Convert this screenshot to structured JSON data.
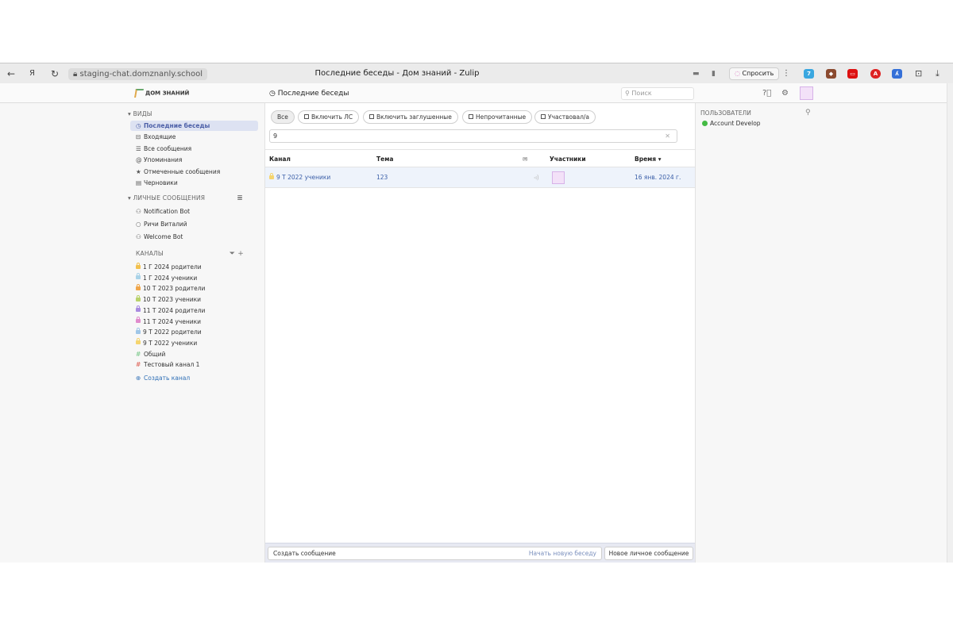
{
  "browser": {
    "back_icon": "arrow-left",
    "yandex_icon": "Я",
    "reload_icon": "reload",
    "url": "staging-chat.domznanly.school",
    "tab_title": "Последние беседы - Дом знаний - Zulip",
    "ask_label": "Спросить"
  },
  "header": {
    "logo_text": "ДОМ ЗНАНИЙ",
    "view_title": "Последние беседы",
    "search_placeholder": "Поиск"
  },
  "views": {
    "title": "ВИДЫ",
    "items": [
      {
        "icon": "clock-icon",
        "glyph": "◷",
        "label": "Последние беседы",
        "active": true
      },
      {
        "icon": "inbox-icon",
        "glyph": "⊟",
        "label": "Входящие"
      },
      {
        "icon": "all-messages-icon",
        "glyph": "☰",
        "label": "Все сообщения"
      },
      {
        "icon": "at-icon",
        "glyph": "@",
        "label": "Упоминания"
      },
      {
        "icon": "star-icon",
        "glyph": "★",
        "label": "Отмеченные сообщения"
      },
      {
        "icon": "draft-icon",
        "glyph": "▤",
        "label": "Черновики"
      }
    ]
  },
  "direct_messages": {
    "title": "ЛИЧНЫЕ СООБЩЕНИЯ",
    "items": [
      {
        "label": "Notification Bot",
        "glyph": "⚇"
      },
      {
        "label": "Ричи Виталий",
        "glyph": "○"
      },
      {
        "label": "Welcome Bot",
        "glyph": "⚇"
      }
    ]
  },
  "channels": {
    "title": "КАНАЛЫ",
    "items": [
      {
        "label": "1 Г 2024 родители",
        "kind": "lock",
        "color": "#f2c14e"
      },
      {
        "label": "1 Г 2024 ученики",
        "kind": "lock",
        "color": "#a9d3e8"
      },
      {
        "label": "10 Т 2023 родители",
        "kind": "lock",
        "color": "#f0a64a"
      },
      {
        "label": "10 Т 2023 ученики",
        "kind": "lock",
        "color": "#b9d26a"
      },
      {
        "label": "11 Т 2024 родители",
        "kind": "lock",
        "color": "#a98be0"
      },
      {
        "label": "11 Т 2024 ученики",
        "kind": "lock",
        "color": "#e08bcc"
      },
      {
        "label": "9 Т 2022 родители",
        "kind": "lock",
        "color": "#9fc6e8"
      },
      {
        "label": "9 Т 2022 ученики",
        "kind": "lock",
        "color": "#f5d56f"
      },
      {
        "label": "Общий",
        "kind": "hash",
        "color": "#8ccf9a"
      },
      {
        "label": "Тестовый канал 1",
        "kind": "hash",
        "color": "#e2786e"
      }
    ],
    "create_label": "Создать канал"
  },
  "filters": {
    "all": "Все",
    "include_dm": "Включить ЛС",
    "include_muted": "Включить заглушенные",
    "unread": "Непрочитанные",
    "participated": "Участвовал/а",
    "search_value": "9"
  },
  "table": {
    "headers": {
      "channel": "Канал",
      "topic": "Тема",
      "participants": "Участники",
      "time": "Время ▾"
    },
    "rows": [
      {
        "channel": "9 Т 2022 ученики",
        "topic": "123",
        "time": "16 янв. 2024 г.",
        "lock_color": "#f5d56f"
      }
    ]
  },
  "compose": {
    "placeholder": "Создать сообщение",
    "new_topic": "Начать новую беседу",
    "new_dm": "Новое личное сообщение"
  },
  "users": {
    "title": "ПОЛЬЗОВАТЕЛИ",
    "items": [
      {
        "name": "Account Develop",
        "status_color": "#44bb44"
      }
    ]
  }
}
